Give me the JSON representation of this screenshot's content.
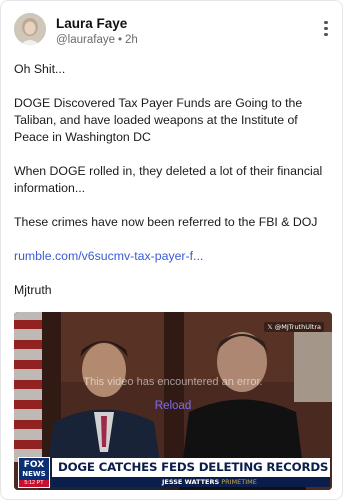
{
  "author": {
    "name": "Laura Faye",
    "handle": "@laurafaye",
    "separator": "•",
    "time": "2h"
  },
  "post": {
    "paragraphs": [
      "Oh Shit...",
      "DOGE Discovered Tax Payer Funds are Going to the Taliban, and have loaded weapons at the Institute of Peace in Washington DC",
      "When DOGE rolled in, they deleted a lot of their financial information...",
      "These crimes have now been referred to the FBI & DOJ"
    ],
    "link": "rumble.com/v6sucmv-tax-payer-f...",
    "signature": "Mjtruth"
  },
  "video": {
    "error_text": "This video has encountered an error.",
    "reload_label": "Reload",
    "watermark": "𝕏 @MJTruthUltra",
    "network_line1": "FOX",
    "network_line2": "NEWS",
    "clock": "5:12 PT",
    "headline": "DOGE CATCHES FEDS DELETING RECORDS",
    "show_name": "JESSE WATTERS",
    "show_tag": "PRIMETIME"
  },
  "colors": {
    "link": "#3b5bd6",
    "reload": "#7f6df0",
    "chyron_navy": "#0b1d4a"
  },
  "icons": [
    "more-options-icon"
  ]
}
